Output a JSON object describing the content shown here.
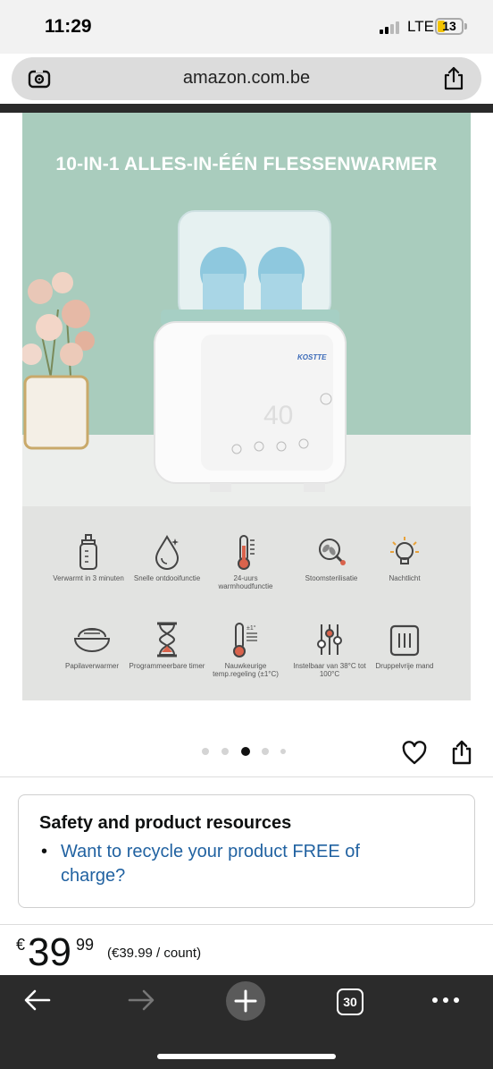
{
  "status_bar": {
    "time": "11:29",
    "network": "LTE",
    "battery": "13"
  },
  "browser": {
    "url": "amazon.com.be",
    "left_icon": "page-settings-icon",
    "right_icon": "share-icon"
  },
  "product_image": {
    "title": "10-IN-1 ALLES-IN-ÉÉN FLESSENWARMER",
    "brand_on_device": "KOSTTE",
    "display_reading": "40",
    "features": [
      {
        "icon": "baby-bottle-icon",
        "label": "Verwarmt in 3 minuten"
      },
      {
        "icon": "droplet-icon",
        "label": "Snelle ontdooifunctie"
      },
      {
        "icon": "thermometer-icon",
        "label": "24-uurs warmhoudfunctie"
      },
      {
        "icon": "germ-icon",
        "label": "Stoomsterilisatie"
      },
      {
        "icon": "light-bulb-icon",
        "label": "Nachtlicht"
      },
      {
        "icon": "food-bowl-icon",
        "label": "Papilaverwarmer"
      },
      {
        "icon": "hourglass-icon",
        "label": "Programmeerbare timer"
      },
      {
        "icon": "precision-thermometer-icon",
        "label": "Nauwkeurige temp.regeling (±1°C)",
        "badge": "±1°"
      },
      {
        "icon": "sliders-icon",
        "label": "Instelbaar van 38°C tot 100°C"
      },
      {
        "icon": "basket-icon",
        "label": "Druppelvrije mand"
      }
    ]
  },
  "carousel": {
    "count": 5,
    "active_index": 2
  },
  "actions": {
    "favorite_icon": "heart-icon",
    "share_icon": "share-icon"
  },
  "resources": {
    "title": "Safety and product resources",
    "bullet": "•",
    "link": "Want to recycle your product FREE of charge?"
  },
  "price": {
    "symbol": "€",
    "whole": "39",
    "fraction": "99",
    "unit_price": "(€39.99 / count)"
  },
  "bottom_nav": {
    "tabs_count": "30"
  },
  "colors": {
    "link": "#2162a1",
    "hero_mint": "#a9ccbd",
    "bottom_bar": "#2b2b2b"
  }
}
